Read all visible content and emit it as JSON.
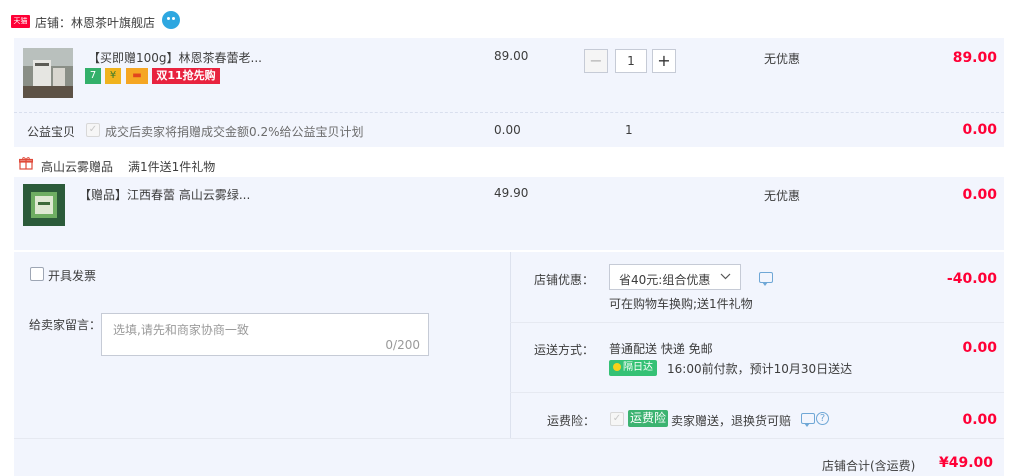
{
  "shop": {
    "logo_text": "天猫",
    "label": "店铺：林恩茶叶旗舰店"
  },
  "item_main": {
    "title": "【买即赠100g】林恩茶春蕾老...",
    "price": "89.00",
    "quantity": "1",
    "discount": "无优惠",
    "subtotal": "89.00",
    "badges": [
      "7",
      "¥",
      "▬",
      "双11抢先购"
    ]
  },
  "charity": {
    "label": "公益宝贝",
    "text": "成交后卖家将捐赠成交金额0.2%给公益宝贝计划",
    "price": "0.00",
    "quantity": "1",
    "subtotal": "0.00"
  },
  "gift_group": {
    "header": "高山云雾赠品",
    "rule": "满1件送1件礼物"
  },
  "item_gift": {
    "title": "【赠品】江西春蕾 高山云雾绿...",
    "price": "49.90",
    "discount": "无优惠",
    "subtotal": "0.00"
  },
  "invoice": {
    "label": "开具发票"
  },
  "message": {
    "label": "给卖家留言：",
    "placeholder": "选填,请先和商家协商一致",
    "counter": "0/200"
  },
  "shop_discount": {
    "label": "店铺优惠：",
    "selected": "省40元:组合优惠",
    "note": "可在购物车换购;送1件礼物",
    "amount": "-40.00"
  },
  "shipping": {
    "label": "运送方式：",
    "method": "普通配送 快递 免邮",
    "badge": "隔日达",
    "eta": "16:00前付款，预计10月30日送达",
    "amount": "0.00"
  },
  "insurance": {
    "label": "运费险：",
    "badge": "运费险",
    "text": "卖家赠送，退换货可赔",
    "amount": "0.00"
  },
  "total": {
    "label": "店铺合计(含运费)",
    "amount": "¥49.00"
  },
  "colors": {
    "accent_red": "#ff0036",
    "panel_blue": "#f2f5fd",
    "tmall_red": "#ff0036",
    "green_badge": "#3cb371"
  }
}
